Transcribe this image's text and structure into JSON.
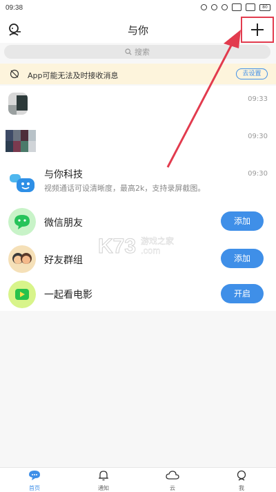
{
  "status_bar": {
    "time": "09:38",
    "battery": "80"
  },
  "header": {
    "title": "与你"
  },
  "search": {
    "placeholder": "搜索"
  },
  "banner": {
    "text": "App可能无法及时接收消息",
    "button": "去设置"
  },
  "conversations": [
    {
      "time": "09:33"
    },
    {
      "time": "09:30"
    },
    {
      "name": "与你科技",
      "preview": "视频通话可设清晰度，最高2k，支持录屏截图。",
      "time": "09:30"
    }
  ],
  "features": [
    {
      "name": "微信朋友",
      "button": "添加"
    },
    {
      "name": "好友群组",
      "button": "添加"
    },
    {
      "name": "一起看电影",
      "button": "开启"
    }
  ],
  "watermark": {
    "logo": "K73",
    "site_cn": "游戏之家",
    "site_en": ".com"
  },
  "tabs": [
    {
      "label": "首页",
      "active": true
    },
    {
      "label": "通知"
    },
    {
      "label": "云"
    },
    {
      "label": "我"
    }
  ],
  "colors": {
    "accent": "#3f8fe8",
    "highlight": "#e23b4e",
    "banner_bg": "#fdf4dc"
  }
}
